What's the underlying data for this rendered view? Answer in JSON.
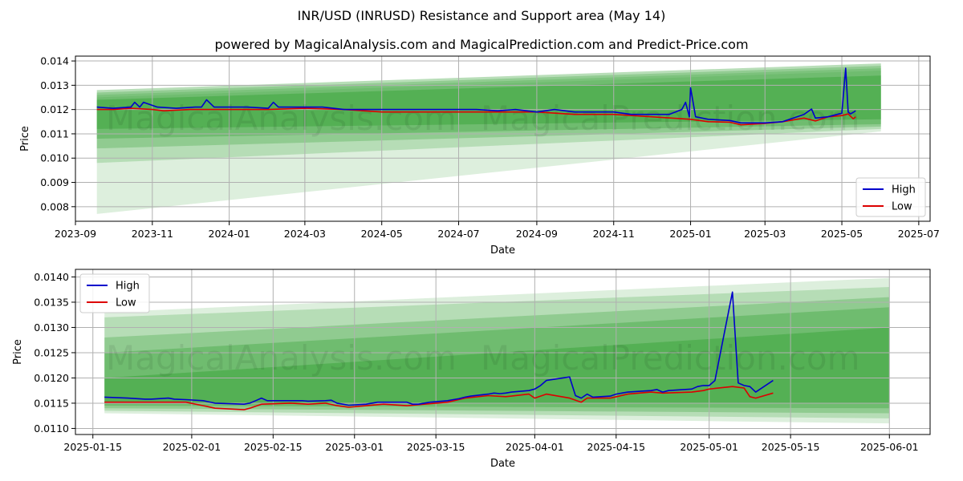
{
  "title": "INR/USD (INRUSD) Resistance and Support area (May 14)",
  "subtitle": "powered by MagicalAnalysis.com and MagicalPrediction.com and Predict-Price.com",
  "watermarks": [
    "MagicalAnalysis.com",
    "MagicalPrediction.com"
  ],
  "colors": {
    "high": "#0000cc",
    "low": "#dd0000",
    "band": "#2e9e2e",
    "grid": "#b0b0b0"
  },
  "chart_data": [
    {
      "type": "line",
      "xlabel": "Date",
      "ylabel": "Price",
      "xlim": [
        "2023-09-01",
        "2025-07-10"
      ],
      "ylim": [
        0.0074,
        0.0142
      ],
      "x_ticks": [
        "2023-09",
        "2023-11",
        "2024-01",
        "2024-03",
        "2024-05",
        "2024-07",
        "2024-09",
        "2024-11",
        "2025-01",
        "2025-03",
        "2025-05",
        "2025-07"
      ],
      "y_ticks": [
        "0.008",
        "0.009",
        "0.010",
        "0.011",
        "0.012",
        "0.013",
        "0.014"
      ],
      "grid": true,
      "legend": "bottom-right",
      "series": [
        {
          "name": "High",
          "x": [
            "2023-09-18",
            "2023-10-01",
            "2023-10-15",
            "2023-10-18",
            "2023-10-22",
            "2023-10-25",
            "2023-11-05",
            "2023-11-20",
            "2023-12-05",
            "2023-12-10",
            "2023-12-14",
            "2023-12-20",
            "2024-01-01",
            "2024-01-15",
            "2024-02-01",
            "2024-02-05",
            "2024-02-09",
            "2024-02-15",
            "2024-03-01",
            "2024-03-15",
            "2024-04-01",
            "2024-04-15",
            "2024-05-01",
            "2024-05-15",
            "2024-06-01",
            "2024-06-15",
            "2024-07-01",
            "2024-07-15",
            "2024-08-01",
            "2024-08-15",
            "2024-09-01",
            "2024-09-15",
            "2024-10-01",
            "2024-10-15",
            "2024-11-01",
            "2024-11-15",
            "2024-12-01",
            "2024-12-15",
            "2024-12-25",
            "2024-12-28",
            "2024-12-31",
            "2025-01-01",
            "2025-01-05",
            "2025-01-15",
            "2025-02-01",
            "2025-02-10",
            "2025-03-01",
            "2025-03-15",
            "2025-04-01",
            "2025-04-07",
            "2025-04-10",
            "2025-04-20",
            "2025-05-01",
            "2025-05-04",
            "2025-05-06",
            "2025-05-08",
            "2025-05-12"
          ],
          "values": [
            0.0121,
            0.01205,
            0.0121,
            0.0123,
            0.0121,
            0.0123,
            0.0121,
            0.01205,
            0.0121,
            0.0121,
            0.0124,
            0.0121,
            0.0121,
            0.0121,
            0.01205,
            0.0123,
            0.0121,
            0.0121,
            0.0121,
            0.0121,
            0.012,
            0.012,
            0.012,
            0.012,
            0.012,
            0.012,
            0.012,
            0.012,
            0.01195,
            0.012,
            0.0119,
            0.012,
            0.0119,
            0.0119,
            0.0119,
            0.0118,
            0.0118,
            0.0118,
            0.012,
            0.0123,
            0.0117,
            0.0129,
            0.0117,
            0.0116,
            0.01155,
            0.01145,
            0.01145,
            0.0115,
            0.0118,
            0.01202,
            0.01165,
            0.0117,
            0.01185,
            0.0137,
            0.0119,
            0.01182,
            0.01195
          ]
        },
        {
          "name": "Low",
          "x": [
            "2023-09-18",
            "2023-10-01",
            "2023-10-15",
            "2023-11-01",
            "2023-11-10",
            "2023-12-01",
            "2024-01-01",
            "2024-02-01",
            "2024-03-01",
            "2024-04-01",
            "2024-05-01",
            "2024-06-01",
            "2024-07-01",
            "2024-08-01",
            "2024-09-01",
            "2024-10-01",
            "2024-11-01",
            "2024-12-01",
            "2025-01-01",
            "2025-01-15",
            "2025-02-01",
            "2025-02-10",
            "2025-03-01",
            "2025-03-15",
            "2025-04-01",
            "2025-04-10",
            "2025-04-20",
            "2025-05-01",
            "2025-05-06",
            "2025-05-10",
            "2025-05-12"
          ],
          "values": [
            0.012,
            0.012,
            0.01205,
            0.012,
            0.01195,
            0.012,
            0.012,
            0.012,
            0.01205,
            0.012,
            0.0119,
            0.0119,
            0.0119,
            0.0119,
            0.0119,
            0.0118,
            0.0118,
            0.0117,
            0.0116,
            0.0115,
            0.01148,
            0.01137,
            0.01143,
            0.0115,
            0.01165,
            0.01153,
            0.0117,
            0.01175,
            0.01182,
            0.01162,
            0.0117
          ]
        }
      ],
      "bands": [
        {
          "start": "2023-09-18",
          "end": "2025-06-01",
          "low_start": 0.0077,
          "high_start": 0.0125,
          "low_end": 0.0111,
          "high_end": 0.0136
        },
        {
          "start": "2023-09-18",
          "end": "2025-06-01",
          "low_start": 0.0098,
          "high_start": 0.0126,
          "low_end": 0.0112,
          "high_end": 0.0137
        },
        {
          "start": "2023-09-18",
          "end": "2025-06-01",
          "low_start": 0.0104,
          "high_start": 0.0127,
          "low_end": 0.0113,
          "high_end": 0.0138
        },
        {
          "start": "2023-09-18",
          "end": "2025-06-01",
          "low_start": 0.0108,
          "high_start": 0.0128,
          "low_end": 0.0114,
          "high_end": 0.0139
        },
        {
          "start": "2023-09-18",
          "end": "2025-06-01",
          "low_start": 0.0112,
          "high_start": 0.0124,
          "low_end": 0.0116,
          "high_end": 0.0134
        }
      ]
    },
    {
      "type": "line",
      "xlabel": "Date",
      "ylabel": "Price",
      "xlim": [
        "2025-01-12",
        "2025-06-08"
      ],
      "ylim": [
        0.01088,
        0.01415
      ],
      "x_ticks": [
        "2025-01-15",
        "2025-02-01",
        "2025-02-15",
        "2025-03-01",
        "2025-03-15",
        "2025-04-01",
        "2025-04-15",
        "2025-05-01",
        "2025-05-15",
        "2025-06-01"
      ],
      "y_ticks": [
        "0.0110",
        "0.0115",
        "0.0120",
        "0.0125",
        "0.0130",
        "0.0135",
        "0.0140"
      ],
      "grid": true,
      "legend": "top-left",
      "series": [
        {
          "name": "High",
          "x": [
            "2025-01-17",
            "2025-01-21",
            "2025-01-24",
            "2025-01-25",
            "2025-01-28",
            "2025-01-29",
            "2025-01-31",
            "2025-02-03",
            "2025-02-05",
            "2025-02-10",
            "2025-02-11",
            "2025-02-12",
            "2025-02-13",
            "2025-02-14",
            "2025-02-18",
            "2025-02-19",
            "2025-02-20",
            "2025-02-21",
            "2025-02-24",
            "2025-02-25",
            "2025-02-26",
            "2025-02-27",
            "2025-02-28",
            "2025-03-03",
            "2025-03-04",
            "2025-03-05",
            "2025-03-06",
            "2025-03-07",
            "2025-03-10",
            "2025-03-11",
            "2025-03-12",
            "2025-03-13",
            "2025-03-14",
            "2025-03-17",
            "2025-03-18",
            "2025-03-19",
            "2025-03-20",
            "2025-03-21",
            "2025-03-24",
            "2025-03-25",
            "2025-03-26",
            "2025-03-27",
            "2025-03-28",
            "2025-03-31",
            "2025-04-01",
            "2025-04-02",
            "2025-04-03",
            "2025-04-07",
            "2025-04-08",
            "2025-04-09",
            "2025-04-10",
            "2025-04-11",
            "2025-04-14",
            "2025-04-15",
            "2025-04-16",
            "2025-04-17",
            "2025-04-21",
            "2025-04-22",
            "2025-04-23",
            "2025-04-24",
            "2025-04-28",
            "2025-04-29",
            "2025-04-30",
            "2025-05-01",
            "2025-05-02",
            "2025-05-05",
            "2025-05-06",
            "2025-05-07",
            "2025-05-08",
            "2025-05-09",
            "2025-05-12"
          ],
          "values": [
            0.01162,
            0.0116,
            0.01158,
            0.01158,
            0.0116,
            0.01158,
            0.01157,
            0.01155,
            0.0115,
            0.01148,
            0.0115,
            0.01155,
            0.0116,
            0.01155,
            0.01155,
            0.01155,
            0.01155,
            0.01154,
            0.01155,
            0.01156,
            0.0115,
            0.01148,
            0.01146,
            0.01148,
            0.0115,
            0.01152,
            0.01152,
            0.01152,
            0.01152,
            0.01148,
            0.01148,
            0.0115,
            0.01152,
            0.01155,
            0.01157,
            0.01159,
            0.01162,
            0.01164,
            0.01168,
            0.0117,
            0.01169,
            0.0117,
            0.01172,
            0.01175,
            0.01178,
            0.01185,
            0.01195,
            0.01202,
            0.01165,
            0.0116,
            0.01168,
            0.01162,
            0.01164,
            0.01168,
            0.0117,
            0.01172,
            0.01175,
            0.01177,
            0.01172,
            0.01175,
            0.01178,
            0.01183,
            0.01185,
            0.01185,
            0.01195,
            0.0137,
            0.0119,
            0.01185,
            0.01183,
            0.01172,
            0.01195
          ]
        },
        {
          "name": "Low",
          "x": [
            "2025-01-17",
            "2025-01-21",
            "2025-01-24",
            "2025-01-28",
            "2025-01-31",
            "2025-02-03",
            "2025-02-05",
            "2025-02-10",
            "2025-02-11",
            "2025-02-13",
            "2025-02-18",
            "2025-02-21",
            "2025-02-24",
            "2025-02-26",
            "2025-02-28",
            "2025-03-03",
            "2025-03-06",
            "2025-03-10",
            "2025-03-13",
            "2025-03-17",
            "2025-03-20",
            "2025-03-24",
            "2025-03-27",
            "2025-03-31",
            "2025-04-01",
            "2025-04-03",
            "2025-04-07",
            "2025-04-09",
            "2025-04-10",
            "2025-04-14",
            "2025-04-17",
            "2025-04-21",
            "2025-04-23",
            "2025-04-28",
            "2025-04-30",
            "2025-05-01",
            "2025-05-05",
            "2025-05-07",
            "2025-05-08",
            "2025-05-09",
            "2025-05-12"
          ],
          "values": [
            0.01152,
            0.01152,
            0.01152,
            0.01152,
            0.01152,
            0.01145,
            0.0114,
            0.01137,
            0.0114,
            0.01148,
            0.0115,
            0.01148,
            0.0115,
            0.01145,
            0.01142,
            0.01145,
            0.01148,
            0.01145,
            0.01148,
            0.01152,
            0.0116,
            0.01165,
            0.01163,
            0.01168,
            0.0116,
            0.01168,
            0.0116,
            0.01152,
            0.0116,
            0.0116,
            0.01168,
            0.01172,
            0.0117,
            0.01172,
            0.01175,
            0.01178,
            0.01183,
            0.0118,
            0.01163,
            0.0116,
            0.0117
          ]
        }
      ],
      "bands": [
        {
          "start": "2025-01-17",
          "end": "2025-06-01",
          "low_start": 0.0113,
          "high_start": 0.0133,
          "low_end": 0.0111,
          "high_end": 0.01398
        },
        {
          "start": "2025-01-17",
          "end": "2025-06-01",
          "low_start": 0.01135,
          "high_start": 0.0132,
          "low_end": 0.0112,
          "high_end": 0.0138
        },
        {
          "start": "2025-01-17",
          "end": "2025-06-01",
          "low_start": 0.0114,
          "high_start": 0.0128,
          "low_end": 0.0113,
          "high_end": 0.0136
        },
        {
          "start": "2025-01-17",
          "end": "2025-06-01",
          "low_start": 0.01145,
          "high_start": 0.0125,
          "low_end": 0.0114,
          "high_end": 0.0134
        },
        {
          "start": "2025-01-17",
          "end": "2025-06-01",
          "low_start": 0.0115,
          "high_start": 0.012,
          "low_end": 0.0115,
          "high_end": 0.013
        }
      ]
    }
  ]
}
